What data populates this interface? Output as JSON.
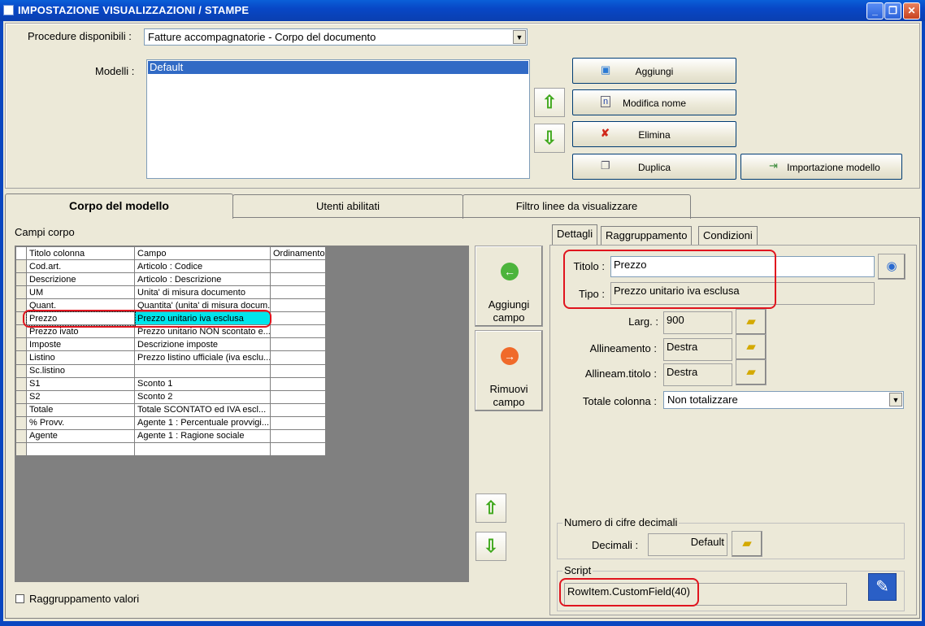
{
  "window": {
    "title": "IMPOSTAZIONE VISUALIZZAZIONI / STAMPE",
    "min": "_",
    "max": "❐",
    "close": "✕"
  },
  "procedure": {
    "label": "Procedure disponibili :",
    "value": "Fatture accompagnatorie - Corpo del documento"
  },
  "modelli": {
    "label": "Modelli :",
    "items": [
      "Default"
    ]
  },
  "buttons": {
    "aggiungi": "Aggiungi",
    "modifica_nome": "Modifica nome",
    "elimina": "Elimina",
    "duplica": "Duplica",
    "importazione": "Importazione modello"
  },
  "tabs": [
    "Corpo del modello",
    "Utenti abilitati",
    "Filtro linee da visualizzare"
  ],
  "campi_label": "Campi corpo",
  "grid": {
    "headers": [
      "Titolo colonna",
      "Campo",
      "Ordinamento"
    ],
    "rows": [
      [
        "Cod.art.",
        "Articolo : Codice",
        ""
      ],
      [
        "Descrizione",
        "Articolo : Descrizione",
        ""
      ],
      [
        "UM",
        "Unita' di misura documento",
        ""
      ],
      [
        "Quant.",
        "Quantita' (unita' di misura docum...",
        ""
      ],
      [
        "Prezzo",
        "Prezzo unitario iva esclusa",
        ""
      ],
      [
        "Prezzo ivato",
        "Prezzo unitario NON scontato e...",
        ""
      ],
      [
        "Imposte",
        "Descrizione imposte",
        ""
      ],
      [
        "Listino",
        "Prezzo listino ufficiale (iva esclu...",
        ""
      ],
      [
        "Sc.listino",
        "",
        ""
      ],
      [
        "S1",
        "Sconto 1",
        ""
      ],
      [
        "S2",
        "Sconto 2",
        ""
      ],
      [
        "Totale",
        "Totale SCONTATO ed IVA escl...",
        ""
      ],
      [
        "% Provv.",
        "Agente 1 : Percentuale provvigi...",
        ""
      ],
      [
        "Agente",
        "Agente 1 : Ragione sociale",
        ""
      ],
      [
        "",
        "",
        ""
      ]
    ]
  },
  "aggiungi_campo": [
    "Aggiungi",
    "campo"
  ],
  "rimuovi_campo": [
    "Rimuovi",
    "campo"
  ],
  "raggruppamento_valori": "Raggruppamento valori",
  "subtabs": [
    "Dettagli",
    "Raggruppamento",
    "Condizioni"
  ],
  "dettagli": {
    "titolo_label": "Titolo :",
    "titolo_value": "Prezzo",
    "tipo_label": "Tipo :",
    "tipo_value": "Prezzo unitario iva esclusa",
    "larg_label": "Larg. :",
    "larg_value": "900",
    "allineamento_label": "Allineamento :",
    "allineamento_value": "Destra",
    "allineam_titolo_label": "Allineam.titolo :",
    "allineam_titolo_value": "Destra",
    "totale_label": "Totale colonna :",
    "totale_value": "Non totalizzare"
  },
  "decimali": {
    "group": "Numero di cifre decimali",
    "label": "Decimali :",
    "value": "Default"
  },
  "script": {
    "group": "Script",
    "value": "RowItem.CustomField(40)"
  },
  "colors": {
    "highlight": "#00E5EC",
    "selection": "#316AC5",
    "annotation": "#E0141E",
    "titlebar": "#0A5FD8"
  }
}
